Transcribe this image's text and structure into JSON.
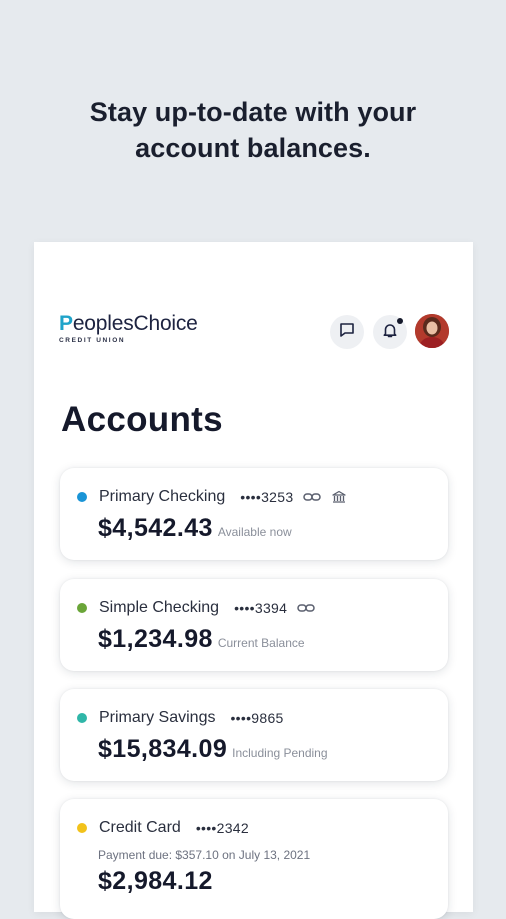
{
  "headline": {
    "line1": "Stay up-to-date with your",
    "line2": "account balances."
  },
  "brand": {
    "name_slash": "P",
    "name_rest": "eoplesChoice",
    "sub": "CREDIT UNION"
  },
  "header_icons": [
    "chat-icon",
    "bell-icon",
    "avatar"
  ],
  "page_title": "Accounts",
  "accounts": [
    {
      "name": "Primary Checking",
      "mask": "••••3253",
      "dot_color": "#1a94d6",
      "icons": [
        "link-icon",
        "bank-icon"
      ],
      "amount": "$4,542.43",
      "note": "Available now"
    },
    {
      "name": "Simple Checking",
      "mask": "••••3394",
      "dot_color": "#6aa538",
      "icons": [
        "link-icon"
      ],
      "amount": "$1,234.98",
      "note": "Current Balance"
    },
    {
      "name": "Primary Savings",
      "mask": "••••9865",
      "dot_color": "#2fb6a8",
      "icons": [],
      "amount": "$15,834.09",
      "note": "Including Pending"
    },
    {
      "name": "Credit Card",
      "mask": "••••2342",
      "dot_color": "#f2c21b",
      "icons": [],
      "due": "Payment due: $357.10 on July 13, 2021",
      "amount": "$2,984.12"
    }
  ],
  "colors": {
    "background": "#e6eaee",
    "brand_accent": "#1fa3c9",
    "text_dark": "#15192b"
  }
}
